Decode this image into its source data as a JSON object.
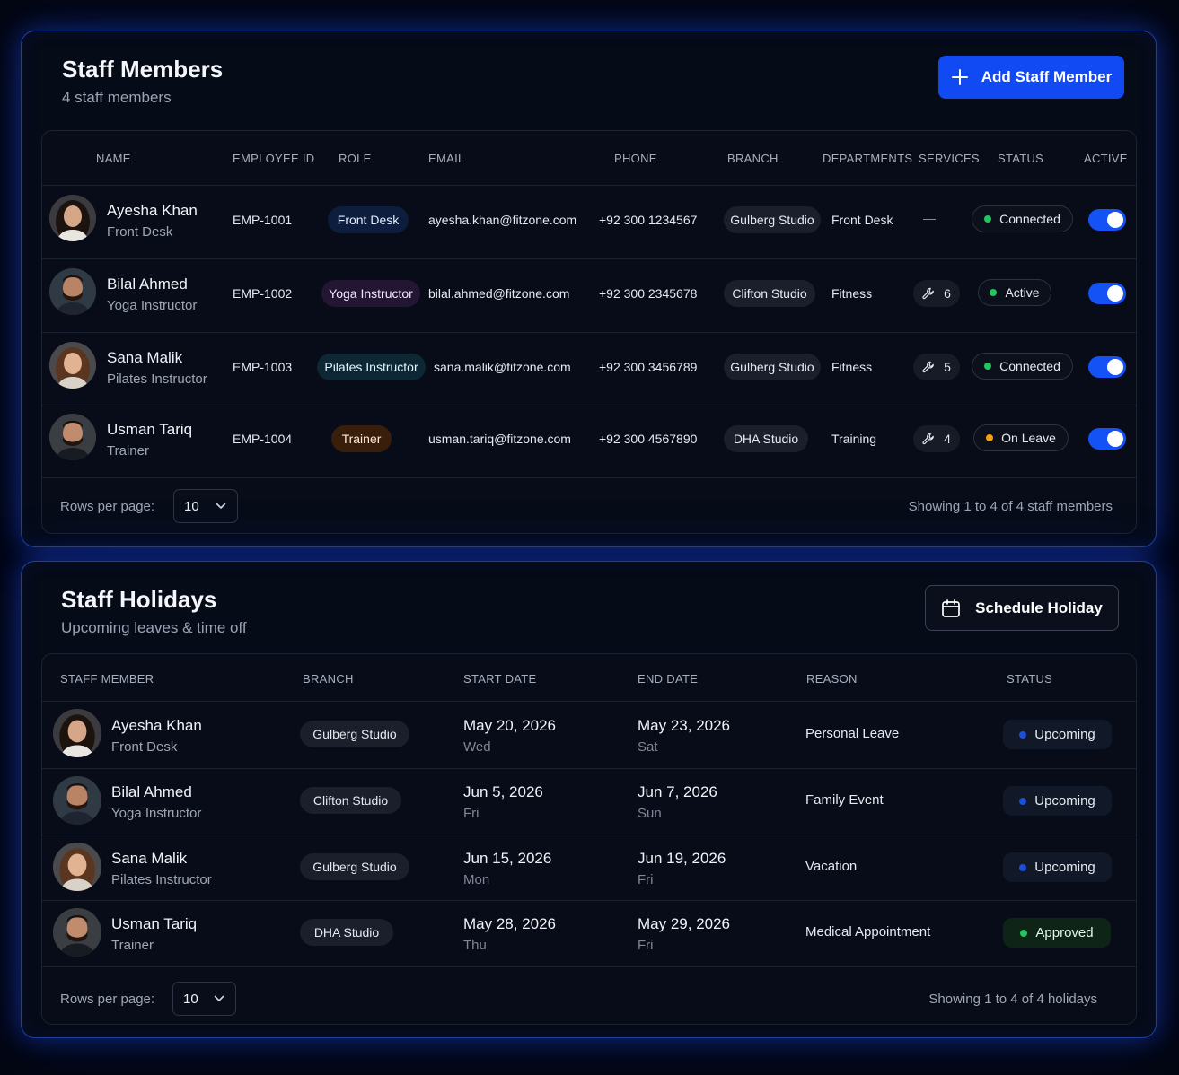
{
  "staff": {
    "title": "Staff Members",
    "count_text": "4 staff members",
    "add_button": "Add Staff Member",
    "headers": {
      "name": "NAME",
      "employee_id": "EMPLOYEE ID",
      "role": "ROLE",
      "email": "EMAIL",
      "phone": "PHONE",
      "branch": "BRANCH",
      "departments": "DEPARTMENTS",
      "services": "SERVICES",
      "status": "STATUS",
      "active": "ACTIVE"
    },
    "rows": [
      {
        "name": "Ayesha Khan",
        "role_sub": "Front Desk",
        "id": "EMP-1001",
        "role": "Front Desk",
        "role_color": "#0c1d3d",
        "email": "ayesha.khan@fitzone.com",
        "phone": "+92 300 1234567",
        "branch": "Gulberg Studio",
        "department": "Front Desk",
        "services": "—",
        "status": "Connected",
        "status_color": "#22c55e",
        "active": true
      },
      {
        "name": "Bilal Ahmed",
        "role_sub": "Yoga Instructor",
        "id": "EMP-1002",
        "role": "Yoga Instructor",
        "role_color": "#231632",
        "email": "bilal.ahmed@fitzone.com",
        "phone": "+92 300 2345678",
        "branch": "Clifton Studio",
        "department": "Fitness",
        "services": "6",
        "status": "Active",
        "status_color": "#22c55e",
        "active": true
      },
      {
        "name": "Sana Malik",
        "role_sub": "Pilates Instructor",
        "id": "EMP-1003",
        "role": "Pilates Instructor",
        "role_color": "#0d2834",
        "email": "sana.malik@fitzone.com",
        "phone": "+92 300 3456789",
        "branch": "Gulberg Studio",
        "department": "Fitness",
        "services": "5",
        "status": "Connected",
        "status_color": "#22c55e",
        "active": true
      },
      {
        "name": "Usman Tariq",
        "role_sub": "Trainer",
        "id": "EMP-1004",
        "role": "Trainer",
        "role_color": "#3a1e0c",
        "email": "usman.tariq@fitzone.com",
        "phone": "+92 300 4567890",
        "branch": "DHA Studio",
        "department": "Training",
        "services": "4",
        "status": "On Leave",
        "status_color": "#f59e0b",
        "active": true
      }
    ],
    "rows_per_page_label": "Rows per page:",
    "rows_per_page": "10",
    "showing": "Showing 1 to 4 of 4 staff members"
  },
  "holidays": {
    "title": "Staff Holidays",
    "subtitle": "Upcoming leaves & time off",
    "schedule_button": "Schedule Holiday",
    "headers": {
      "staff_member": "STAFF MEMBER",
      "branch": "BRANCH",
      "start_date": "START DATE",
      "end_date": "END DATE",
      "reason": "REASON",
      "status": "STATUS"
    },
    "rows": [
      {
        "name": "Ayesha Khan",
        "role": "Front Desk",
        "branch": "Gulberg Studio",
        "start": "May 20, 2026",
        "start_day": "Wed",
        "end": "May 23, 2026",
        "end_day": "Sat",
        "reason": "Personal Leave",
        "status": "Upcoming",
        "status_color": "#1d4ed8"
      },
      {
        "name": "Bilal Ahmed",
        "role": "Yoga Instructor",
        "branch": "Clifton Studio",
        "start": "Jun 5, 2026",
        "start_day": "Fri",
        "end": "Jun 7, 2026",
        "end_day": "Sun",
        "reason": "Family Event",
        "status": "Upcoming",
        "status_color": "#1d4ed8"
      },
      {
        "name": "Sana Malik",
        "role": "Pilates Instructor",
        "branch": "Gulberg Studio",
        "start": "Jun 15, 2026",
        "start_day": "Mon",
        "end": "Jun 19, 2026",
        "end_day": "Fri",
        "reason": "Vacation",
        "status": "Upcoming",
        "status_color": "#1d4ed8"
      },
      {
        "name": "Usman Tariq",
        "role": "Trainer",
        "branch": "DHA Studio",
        "start": "May 28, 2026",
        "start_day": "Thu",
        "end": "May 29, 2026",
        "end_day": "Fri",
        "reason": "Medical Appointment",
        "status": "Approved",
        "status_color": "#22c55e"
      }
    ],
    "rows_per_page_label": "Rows per page:",
    "rows_per_page": "10",
    "showing": "Showing 1 to 4 of 4 holidays"
  },
  "icons": {
    "add": "plus-icon",
    "schedule": "calendar-icon",
    "services": "wrench-icon",
    "dropdown": "chevron-down-icon"
  },
  "colors": {
    "accent": "#1149f2",
    "background": "#030611",
    "card_border": "#1d3f9e"
  }
}
